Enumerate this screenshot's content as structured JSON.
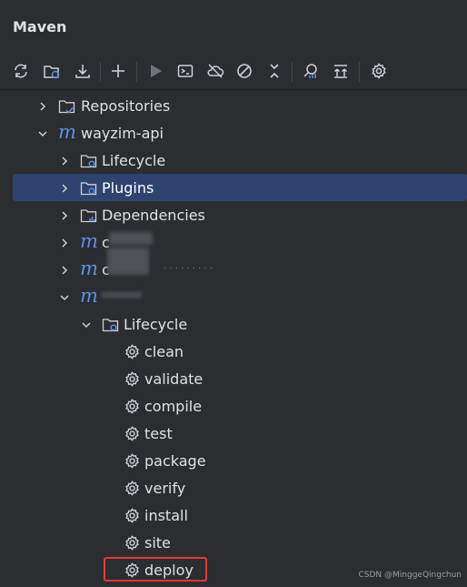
{
  "panel": {
    "title": "Maven"
  },
  "toolbar": {
    "buttons": [
      {
        "name": "reload-icon"
      },
      {
        "name": "generate-sources-icon"
      },
      {
        "name": "download-icon"
      },
      {
        "name": "add-icon"
      },
      {
        "name": "run-icon"
      },
      {
        "name": "execute-goal-icon"
      },
      {
        "name": "offline-mode-icon"
      },
      {
        "name": "skip-tests-icon"
      },
      {
        "name": "collapse-all-icon"
      },
      {
        "name": "analyze-dependencies-icon"
      },
      {
        "name": "show-dependencies-icon"
      },
      {
        "name": "settings-icon"
      }
    ]
  },
  "tree": {
    "repositories": "Repositories",
    "project": "wayzim-api",
    "lifecycle": "Lifecycle",
    "plugins": "Plugins",
    "dependencies": "Dependencies",
    "module_a": "c",
    "module_b": "c",
    "module_b_suffix": "· · · · · · · · ·",
    "module_c": "",
    "sub_lifecycle": "Lifecycle",
    "goals": [
      "clean",
      "validate",
      "compile",
      "test",
      "package",
      "verify",
      "install",
      "site",
      "deploy"
    ]
  },
  "watermark": "CSDN @MinggeQingchun",
  "colors": {
    "background": "#2b2d30",
    "selection": "#2e436e",
    "maven_blue": "#5d8ee8",
    "highlight": "#e53935"
  }
}
